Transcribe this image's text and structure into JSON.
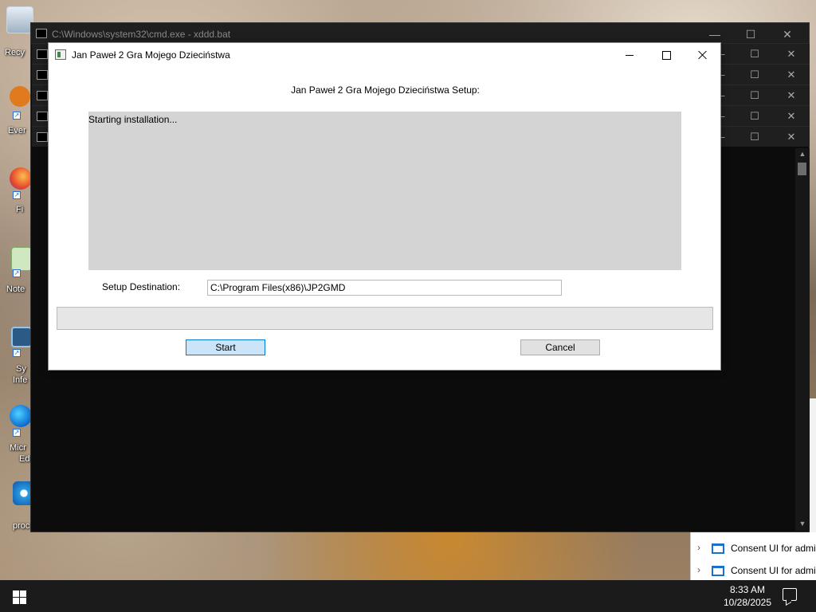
{
  "desktop": {
    "icons": [
      {
        "label": "Recy",
        "icon": "recycle-bin-icon"
      },
      {
        "label": "Ever",
        "icon": "everything-icon"
      },
      {
        "label": "Fi",
        "icon": "firefox-icon"
      },
      {
        "label": "Note",
        "icon": "notepad-icon"
      },
      {
        "label": "Sy",
        "icon": "system-info-icon"
      },
      {
        "label": "Infe",
        "icon": "system-info-icon"
      },
      {
        "label": "Micr",
        "icon": "edge-icon"
      },
      {
        "label": "Ed",
        "icon": "edge-icon"
      },
      {
        "label": "proc",
        "icon": "process-icon"
      }
    ]
  },
  "cmd": {
    "title": "C:\\Windows\\system32\\cmd.exe - xddd.bat",
    "icon": "cmd-icon"
  },
  "setup": {
    "window_title": "Jan Paweł 2 Gra Mojego Dzieciństwa",
    "heading": "Jan Paweł 2 Gra Mojego Dzieciństwa Setup:",
    "log_text": "Starting installation...",
    "destination_label": "Setup Destination:",
    "destination_value": "C:\\Program Files(x86)\\JP2GMD",
    "progress_percent": 0,
    "start_label": "Start",
    "cancel_label": "Cancel"
  },
  "notifications": [
    {
      "text": "Consent UI for admi"
    },
    {
      "text": "Consent UI for admi"
    }
  ],
  "taskbar": {
    "time": "8:33 AM",
    "date": "10/28/2025"
  },
  "colors": {
    "accent": "#0078d7",
    "start_button_bg": "#cce4f7",
    "log_bg": "#d4d4d4",
    "taskbar_bg": "#1b1b1b",
    "cmd_bg": "#0c0c0c"
  }
}
